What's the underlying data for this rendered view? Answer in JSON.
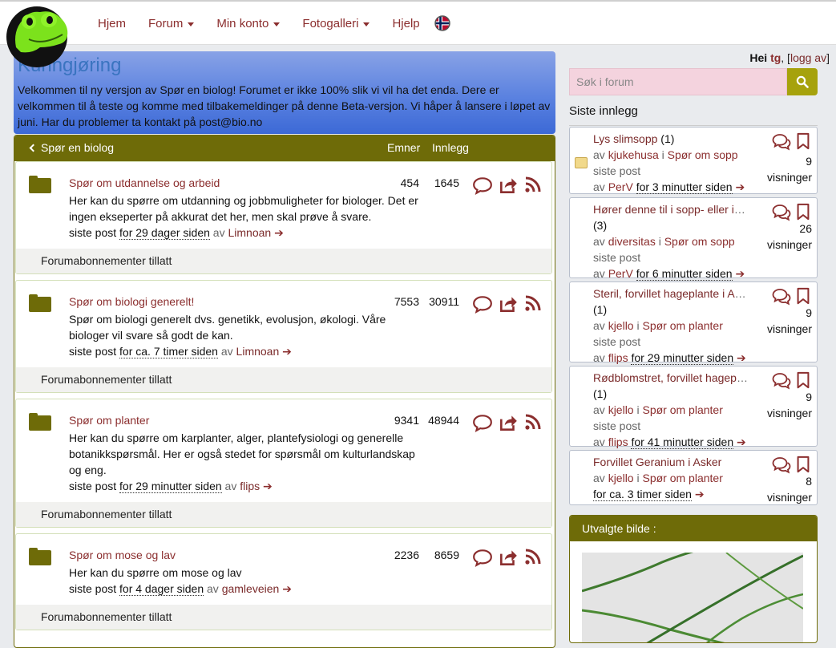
{
  "nav": {
    "items": [
      {
        "label": "Hjem",
        "caret": false
      },
      {
        "label": "Forum",
        "caret": true
      },
      {
        "label": "Min konto",
        "caret": true
      },
      {
        "label": "Fotogalleri",
        "caret": true
      },
      {
        "label": "Hjelp",
        "caret": false
      }
    ],
    "flag_icon": "norway-flag-icon"
  },
  "announcement": {
    "title": "Kunngjøring",
    "text": "Velkommen til ny versjon av Spør en biolog! Forumet er ikke 100% slik vi vil ha det enda. Dere er velkommen til å teste og komme med tilbakemeldinger på denne Beta-versjon. Vi håper å lansere i løpet av juni. Har du problemer ta kontakt på post@bio.no"
  },
  "forum": {
    "back_label": "Spør en biolog",
    "col_emner": "Emner",
    "col_innlegg": "Innlegg",
    "footer_label": "Forumabonnementer tillatt",
    "last_post_prefix": "siste post",
    "by_prefix": "av",
    "categories": [
      {
        "title": "Spør om utdannelse og arbeid",
        "desc": "Her kan du spørre om utdanning og jobbmuligheter for biologer. Det er ingen ekseperter på akkurat det her, men skal prøve å svare.",
        "emner": "454",
        "innlegg": "1645",
        "time": "for 29 dager siden",
        "user": "Limnoan"
      },
      {
        "title": "Spør om biologi generelt!",
        "desc": "Spør om biologi generelt dvs. genetikk, evolusjon, økologi. Våre biologer vil svare så godt de kan.",
        "emner": "7553",
        "innlegg": "30911",
        "time": "for ca. 7 timer siden",
        "user": "Limnoan"
      },
      {
        "title": "Spør om planter",
        "desc": "Her kan du spørre om karplanter, alger, plantefysiologi og generelle botanikkspørsmål. Her er også stedet for spørsmål om kulturlandskap og eng.",
        "emner": "9341",
        "innlegg": "48944",
        "time": "for 29 minutter siden",
        "user": "flips"
      },
      {
        "title": "Spør om mose og lav",
        "desc": "Her kan du spørre om mose og lav",
        "emner": "2236",
        "innlegg": "8659",
        "time": "for 4 dager siden",
        "user": "gamleveien"
      }
    ]
  },
  "user": {
    "greeting": "Hei",
    "name": "tg",
    "logout": "logg av"
  },
  "search": {
    "placeholder": "Søk i forum"
  },
  "recent": {
    "title": "Siste innlegg",
    "views_label": "visninger",
    "last_post_label": "siste post",
    "posts": [
      {
        "title": "Lys slimsopp",
        "count": "(1)",
        "author": "kjukehusa",
        "forum": "Spør om sopp",
        "last_user": "PerV",
        "time": "for 3 minutter siden",
        "views": "9"
      },
      {
        "title": "Hører denne til i sopp- eller insekt...",
        "count": "(3)",
        "author": "diversitas",
        "forum": "Spør om sopp",
        "last_user": "PerV",
        "time": "for 6 minutter siden",
        "views": "26"
      },
      {
        "title": "Steril, forvillet hageplante i Asker",
        "count": "(1)",
        "author": "kjello",
        "forum": "Spør om planter",
        "last_user": "flips",
        "time": "for 29 minutter siden",
        "views": "9"
      },
      {
        "title": "Rødblomstret, forvillet hageplante",
        "count": "(1)",
        "author": "kjello",
        "forum": "Spør om planter",
        "last_user": "flips",
        "time": "for 41 minutter siden",
        "views": "9"
      },
      {
        "title": "Forvillet Geranium i Asker",
        "count": "",
        "author": "kjello",
        "forum": "Spør om planter",
        "last_user": "",
        "time": "for ca. 3 timer siden",
        "views": "8"
      }
    ]
  },
  "featured": {
    "title": "Utvalgte bilde :"
  },
  "colors": {
    "olive": "#6e6b08",
    "link": "#8b2e2e",
    "search_bg": "#f4d3de",
    "button": "#a6a20c"
  }
}
